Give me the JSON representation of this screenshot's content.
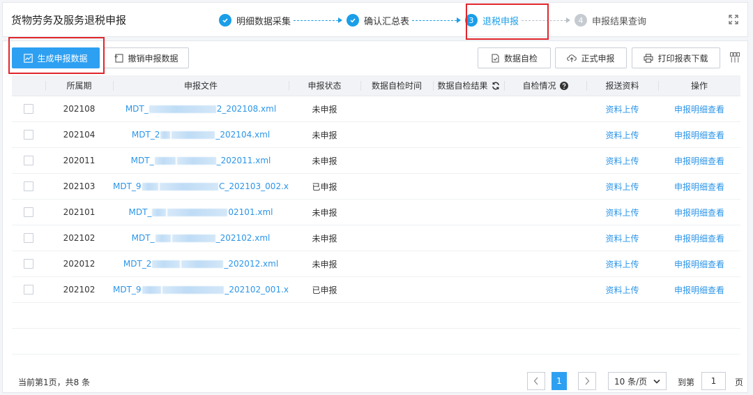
{
  "header": {
    "title": "货物劳务及服务退税申报",
    "steps": [
      {
        "num": "",
        "label": "明细数据采集",
        "state": "done"
      },
      {
        "num": "",
        "label": "确认汇总表",
        "state": "done"
      },
      {
        "num": "3",
        "label": "退税申报",
        "state": "active"
      },
      {
        "num": "4",
        "label": "申报结果查询",
        "state": "todo"
      }
    ]
  },
  "toolbar": {
    "generate_label": "生成申报数据",
    "revoke_label": "撤销申报数据",
    "selfcheck_label": "数据自检",
    "formal_label": "正式申报",
    "print_label": "打印报表下载"
  },
  "table": {
    "columns": [
      "所属期",
      "申报文件",
      "申报状态",
      "数据自检时间",
      "数据自检结果",
      "自检情况",
      "报送资料",
      "操作"
    ],
    "rows": [
      {
        "period": "202108",
        "file_prefix": "MDT_",
        "file_suffix": "2_202108.xml",
        "status": "未申报",
        "upload": "资料上传",
        "action": "申报明细查看"
      },
      {
        "period": "202104",
        "file_prefix": "MDT_2",
        "file_suffix": "_202104.xml",
        "status": "未申报",
        "upload": "资料上传",
        "action": "申报明细查看"
      },
      {
        "period": "202011",
        "file_prefix": "MDT_",
        "file_suffix": "_202011.xml",
        "status": "未申报",
        "upload": "资料上传",
        "action": "申报明细查看"
      },
      {
        "period": "202103",
        "file_prefix": "MDT_9",
        "file_suffix": "C_202103_002.x",
        "status": "已申报",
        "upload": "资料上传",
        "action": "申报明细查看"
      },
      {
        "period": "202101",
        "file_prefix": "MDT_",
        "file_suffix": "02101.xml",
        "status": "未申报",
        "upload": "资料上传",
        "action": "申报明细查看"
      },
      {
        "period": "202102",
        "file_prefix": "MDT_",
        "file_suffix": "_202102.xml",
        "status": "未申报",
        "upload": "资料上传",
        "action": "申报明细查看"
      },
      {
        "period": "202012",
        "file_prefix": "MDT_2",
        "file_suffix": "_202012.xml",
        "status": "未申报",
        "upload": "资料上传",
        "action": "申报明细查看"
      },
      {
        "period": "202102",
        "file_prefix": "MDT_9",
        "file_suffix": "_202102_001.x",
        "status": "已申报",
        "upload": "资料上传",
        "action": "申报明细查看"
      }
    ]
  },
  "footer": {
    "total_text": "当前第1页，共8 条",
    "current_page": "1",
    "page_size": "10 条/页",
    "goto_label": "到第",
    "goto_value": "1",
    "page_unit": "页"
  },
  "colors": {
    "accent": "#2ea0f2",
    "link": "#2b95e9",
    "highlight": "#e0262c"
  }
}
